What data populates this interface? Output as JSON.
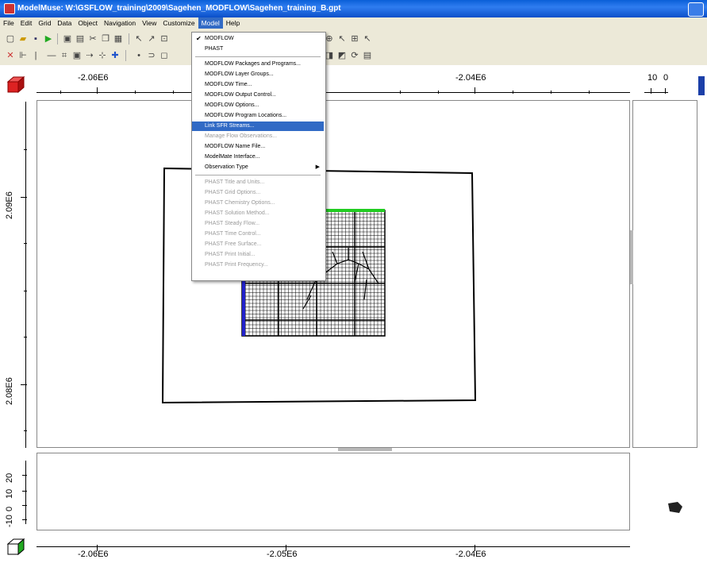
{
  "window": {
    "title": "ModelMuse: W:\\GSFLOW_training\\2009\\Sagehen_MODFLOW\\Sagehen_training_B.gpt"
  },
  "menubar": {
    "items": [
      "File",
      "Edit",
      "Grid",
      "Data",
      "Object",
      "Navigation",
      "View",
      "Customize",
      "Model",
      "Help"
    ]
  },
  "model_menu": {
    "items": [
      {
        "label": "MODFLOW",
        "checked": true,
        "enabled": true
      },
      {
        "label": "PHAST",
        "enabled": true
      },
      {
        "label": "MODFLOW Packages and Programs...",
        "enabled": true
      },
      {
        "label": "MODFLOW Layer Groups...",
        "enabled": true
      },
      {
        "label": "MODFLOW Time...",
        "enabled": true
      },
      {
        "label": "MODFLOW Output Control...",
        "enabled": true
      },
      {
        "label": "MODFLOW Options...",
        "enabled": true
      },
      {
        "label": "MODFLOW Program Locations...",
        "enabled": true
      },
      {
        "label": "Link SFR Streams...",
        "enabled": true,
        "highlighted": true
      },
      {
        "label": "Manage Flow Observations...",
        "enabled": false
      },
      {
        "label": "MODFLOW Name File...",
        "enabled": true
      },
      {
        "label": "ModelMate Interface...",
        "enabled": true
      },
      {
        "label": "Observation Type",
        "enabled": true,
        "submenu": true
      },
      {
        "label": "PHAST Title and Units...",
        "enabled": false
      },
      {
        "label": "PHAST Grid Options...",
        "enabled": false
      },
      {
        "label": "PHAST Chemistry Options...",
        "enabled": false
      },
      {
        "label": "PHAST Solution Method...",
        "enabled": false
      },
      {
        "label": "PHAST Steady Flow...",
        "enabled": false
      },
      {
        "label": "PHAST Time Control...",
        "enabled": false
      },
      {
        "label": "PHAST Free Surface...",
        "enabled": false
      },
      {
        "label": "PHAST Print Initial...",
        "enabled": false
      },
      {
        "label": "PHAST Print Frequency...",
        "enabled": false
      }
    ]
  },
  "top_ruler": {
    "labels": [
      "-2.06E6",
      "-2.04E6"
    ]
  },
  "side_ruler": {
    "labels": [
      "10",
      "0"
    ]
  },
  "left_ruler": {
    "labels": [
      "2.09E6",
      "2.08E6"
    ]
  },
  "front_left_ruler": {
    "labels": [
      "20",
      "10",
      "0",
      "-10"
    ]
  },
  "bottom_ruler": {
    "labels": [
      "-2.06E6",
      "-2.05E6",
      "-2.04E6"
    ]
  },
  "colors": {
    "accent": "#316ac5",
    "grid_top_row": "#22cc22",
    "grid_left_col": "#2222cc",
    "cube_top": "#cc2222",
    "cube_front": "#22aa22"
  }
}
